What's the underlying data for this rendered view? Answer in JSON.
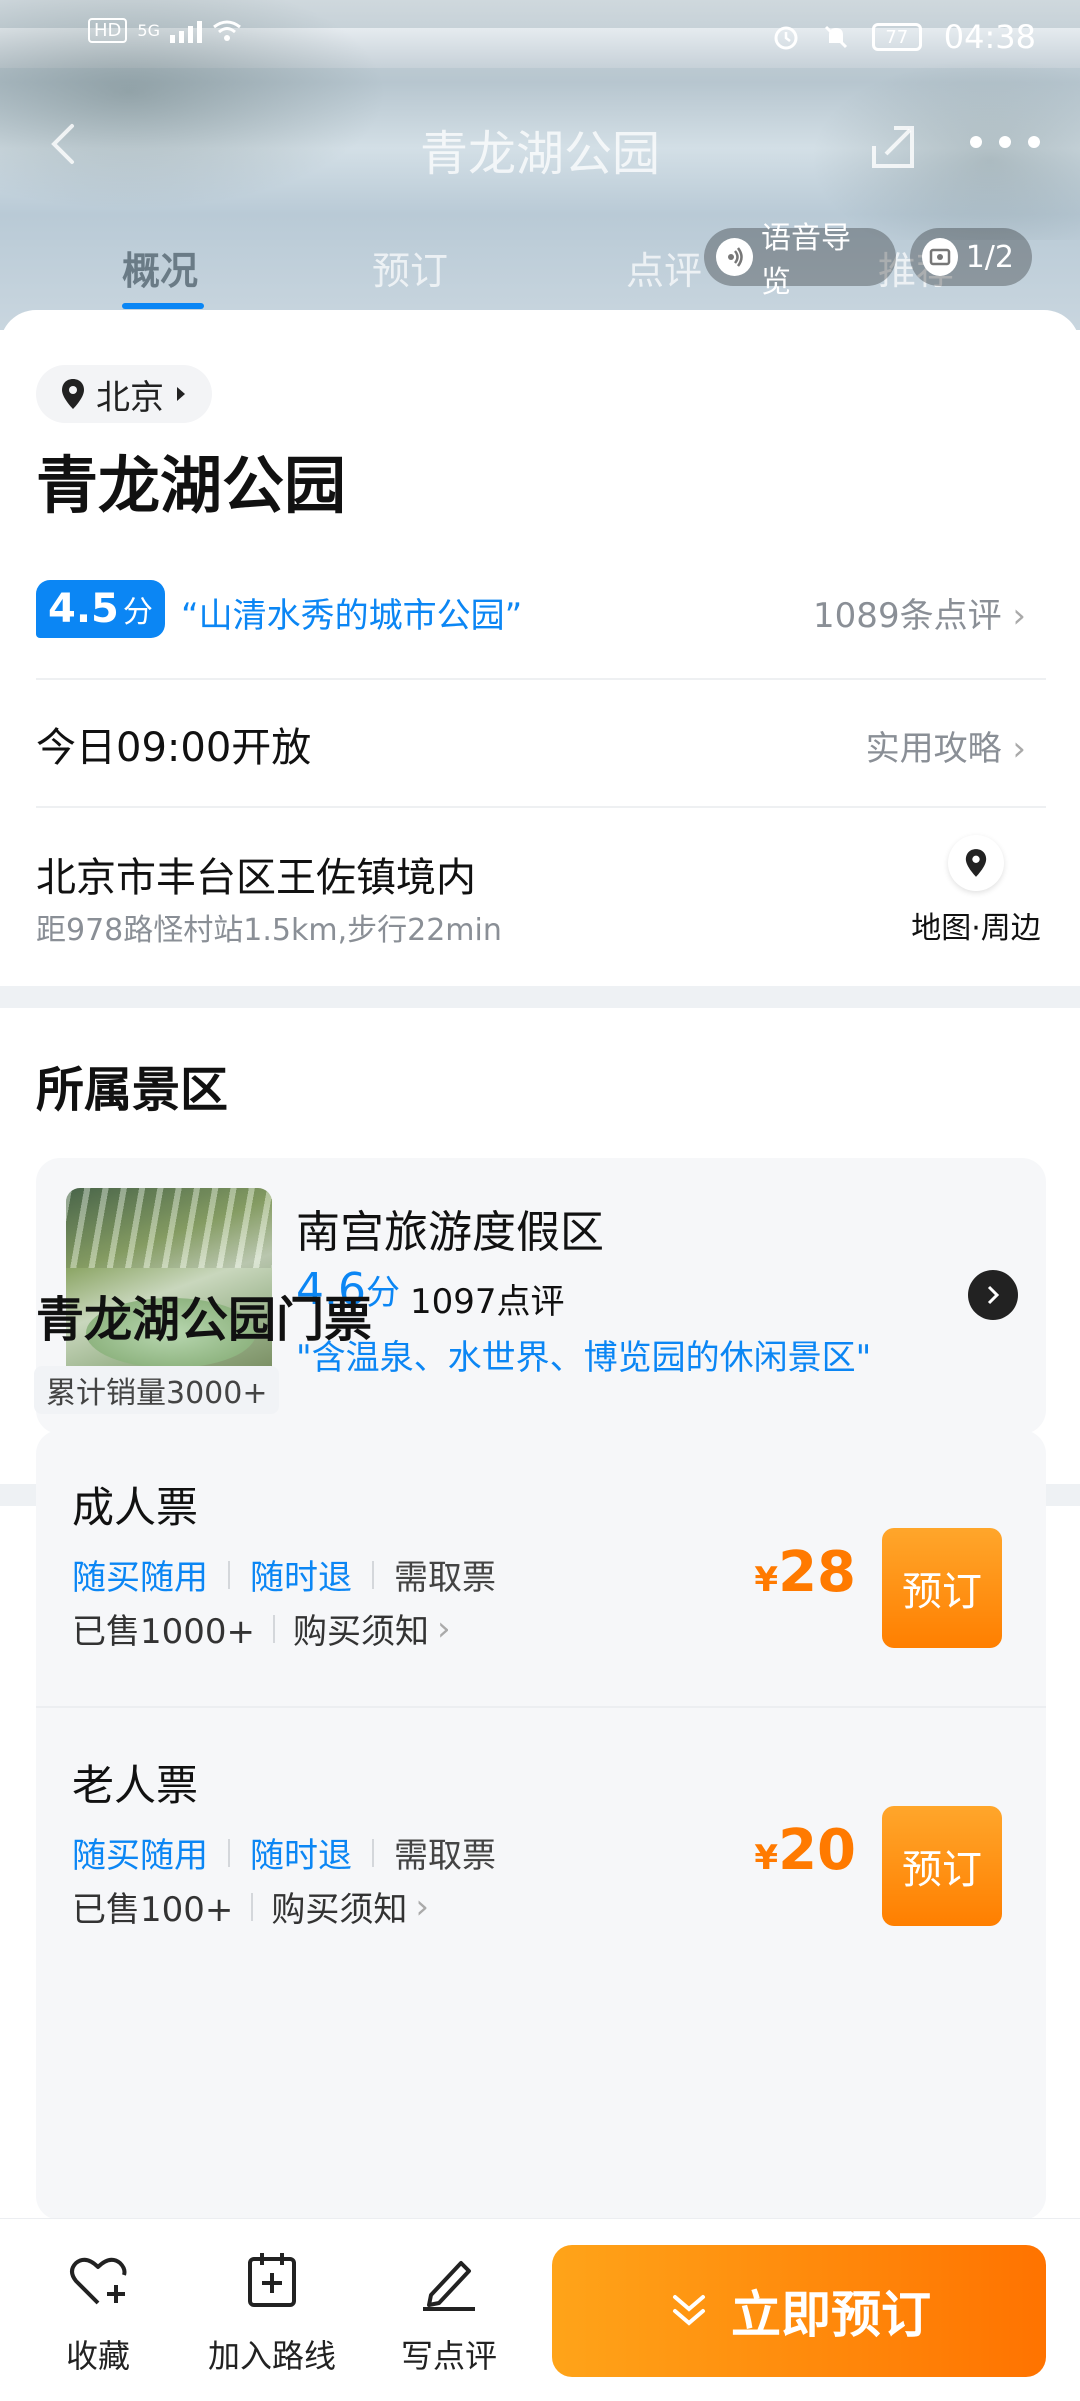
{
  "status_bar": {
    "time": "04:38",
    "battery": "77",
    "hd_label": "HD",
    "network_label": "5G"
  },
  "header": {
    "title": "青龙湖公园",
    "tabs": [
      {
        "label": "概况"
      },
      {
        "label": "预订"
      },
      {
        "label": "点评"
      },
      {
        "label": "推荐"
      }
    ],
    "audio_guide": "语音导览",
    "photo_index": "1/2"
  },
  "summary": {
    "city": "北京",
    "name": "青龙湖公园",
    "rating": "4.5",
    "rating_unit": "分",
    "quote": "“山清水秀的城市公园”",
    "review_count": "1089条点评",
    "opening": "今日09:00开放",
    "guide_link": "实用攻略",
    "address": "北京市丰台区王佐镇境内",
    "distance": "距978路怪村站1.5km,步行22min",
    "map_label": "地图·周边"
  },
  "scenic_area": {
    "section_title": "所属景区",
    "name": "南宫旅游度假区",
    "rating": "4.6",
    "rating_unit": "分",
    "reviews": "1097点评",
    "quote": "\"含温泉、水世界、博览园的休闲景区\""
  },
  "tickets": {
    "section_title": "青龙湖公园门票",
    "sales": "累计销量3000+",
    "items": [
      {
        "name": "成人票",
        "tag1": "随买随用",
        "tag2": "随时退",
        "tag3": "需取票",
        "sold": "已售1000+",
        "notice": "购买须知",
        "currency": "¥",
        "price": "28",
        "book": "预订"
      },
      {
        "name": "老人票",
        "tag1": "随买随用",
        "tag2": "随时退",
        "tag3": "需取票",
        "sold": "已售100+",
        "notice": "购买须知",
        "currency": "¥",
        "price": "20",
        "book": "预订"
      }
    ]
  },
  "bottom_bar": {
    "favorite": "收藏",
    "add_route": "加入路线",
    "write_review": "写点评",
    "book_now": "立即预订"
  },
  "colors": {
    "accent_blue": "#0b86f4",
    "accent_orange": "#ff7a00"
  },
  "icons": [
    "back-icon",
    "share-icon",
    "more-icon",
    "audio-icon",
    "gallery-icon",
    "location-pin-icon",
    "chevron-right-icon",
    "heart-plus-icon",
    "calendar-plus-icon",
    "pen-icon",
    "double-chevron-down-icon"
  ]
}
